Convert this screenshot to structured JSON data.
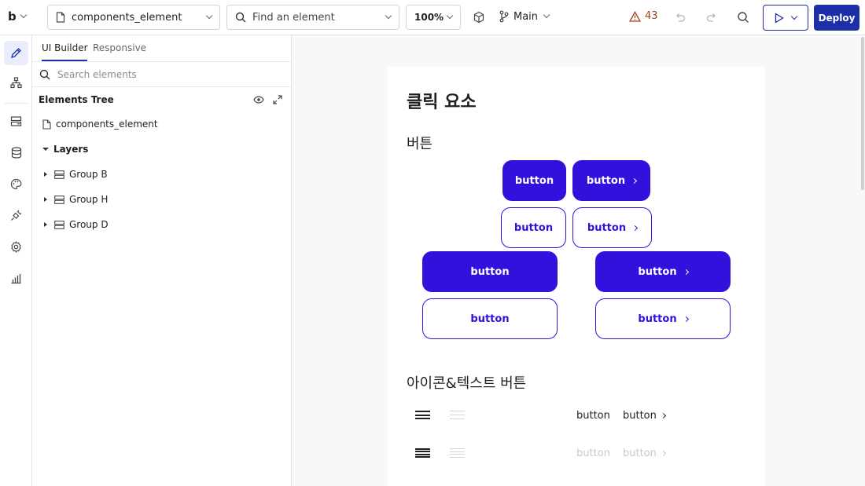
{
  "topbar": {
    "logo": "b",
    "file_selector": "components_element",
    "find_placeholder": "Find an element",
    "zoom": "100%",
    "branch": "Main",
    "warnings": "43",
    "deploy": "Deploy"
  },
  "panel": {
    "tabs": [
      "UI Builder",
      "Responsive"
    ],
    "search_placeholder": "Search elements",
    "tree_title": "Elements Tree",
    "page_item": "components_element",
    "layers": "Layers",
    "groups": [
      "Group B",
      "Group H",
      "Group D"
    ]
  },
  "canvas": {
    "title": "클릭 요소",
    "section_buttons": "버튼",
    "button_label": "button",
    "section_icon_text": "아이콘&텍스트 버튼"
  },
  "colors": {
    "accent": "#3012dc",
    "deploy": "#1c2fa6",
    "warning": "#a0431b"
  }
}
